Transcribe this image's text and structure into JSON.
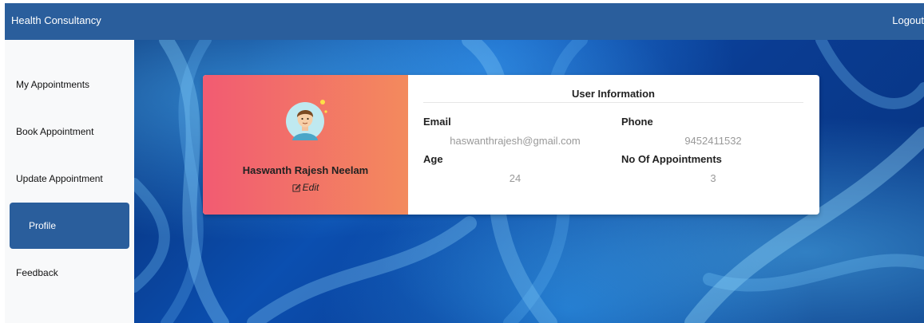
{
  "header": {
    "brand": "Health Consultancy",
    "logout_label": "Logout"
  },
  "sidebar": {
    "items": [
      {
        "label": "My Appointments"
      },
      {
        "label": "Book Appointment"
      },
      {
        "label": "Update Appointment"
      },
      {
        "label": "Profile",
        "active": true
      },
      {
        "label": "Feedback"
      }
    ]
  },
  "profile": {
    "name": "Haswanth Rajesh Neelam",
    "edit_label": "Edit",
    "avatar_icon": "user-avatar-icon",
    "edit_icon": "edit-icon"
  },
  "user_info": {
    "title": "User Information",
    "email_label": "Email",
    "email_value": "haswanthrajesh@gmail.com",
    "phone_label": "Phone",
    "phone_value": "9452411532",
    "age_label": "Age",
    "age_value": "24",
    "appointments_label": "No Of Appointments",
    "appointments_value": "3"
  },
  "colors": {
    "header_bg": "#2a5e9c",
    "active_nav_bg": "#2a5e9c",
    "card_gradient_start": "#f25b72",
    "card_gradient_end": "#f38a5d"
  }
}
